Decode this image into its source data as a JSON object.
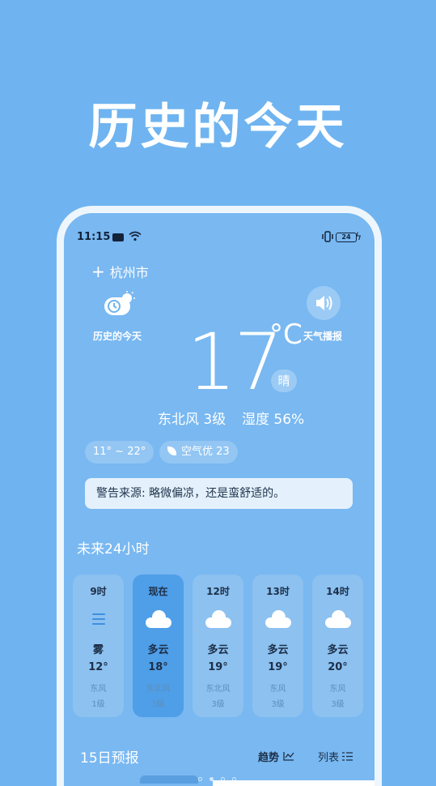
{
  "headline": "历史的今天",
  "status_bar": {
    "time": "11:15",
    "battery": "24",
    "icons": [
      "message-icon",
      "wifi-icon",
      "vibrate-icon",
      "battery-icon",
      "charging-icon"
    ]
  },
  "location": {
    "add_symbol": "+",
    "city": "杭州市"
  },
  "history": {
    "icon": "cloud-sun-clock-icon",
    "label": "历史的今天"
  },
  "broadcast": {
    "icon": "speaker-icon",
    "label": "天气播报"
  },
  "current": {
    "temperature": "17",
    "unit": "°C",
    "condition": "晴",
    "wind": "东北风 3级",
    "humidity": "湿度 56%"
  },
  "chips": {
    "range": "11° ~ 22°",
    "air_quality": "空气优 23",
    "air_icon": "leaf-icon"
  },
  "alert": {
    "text": "警告来源:  略微偏凉，还是蛮舒适的。"
  },
  "hourly": {
    "title": "未来24小时",
    "items": [
      {
        "time": "9时",
        "icon": "fog-icon",
        "condition": "雾",
        "temp": "12°",
        "wind": "东风",
        "level": "1级"
      },
      {
        "time": "现在",
        "icon": "cloud-icon",
        "condition": "多云",
        "temp": "18°",
        "wind": "东北风",
        "level": "3级"
      },
      {
        "time": "12时",
        "icon": "cloud-icon",
        "condition": "多云",
        "temp": "19°",
        "wind": "东北风",
        "level": "3级"
      },
      {
        "time": "13时",
        "icon": "cloud-icon",
        "condition": "多云",
        "temp": "19°",
        "wind": "东风",
        "level": "3级"
      },
      {
        "time": "14时",
        "icon": "cloud-icon",
        "condition": "多云",
        "temp": "20°",
        "wind": "东风",
        "level": "3级"
      }
    ]
  },
  "forecast": {
    "title": "15日预报",
    "trend_label": "趋势",
    "trend_icon": "chart-line-icon",
    "list_label": "列表",
    "list_icon": "list-icon",
    "page_count": 4,
    "active_page": 2
  },
  "colors": {
    "background": "#6fb4f0",
    "card": "#8cc1f0",
    "card_active": "#4f9ee8",
    "alert_bg": "#e4f1fc"
  }
}
